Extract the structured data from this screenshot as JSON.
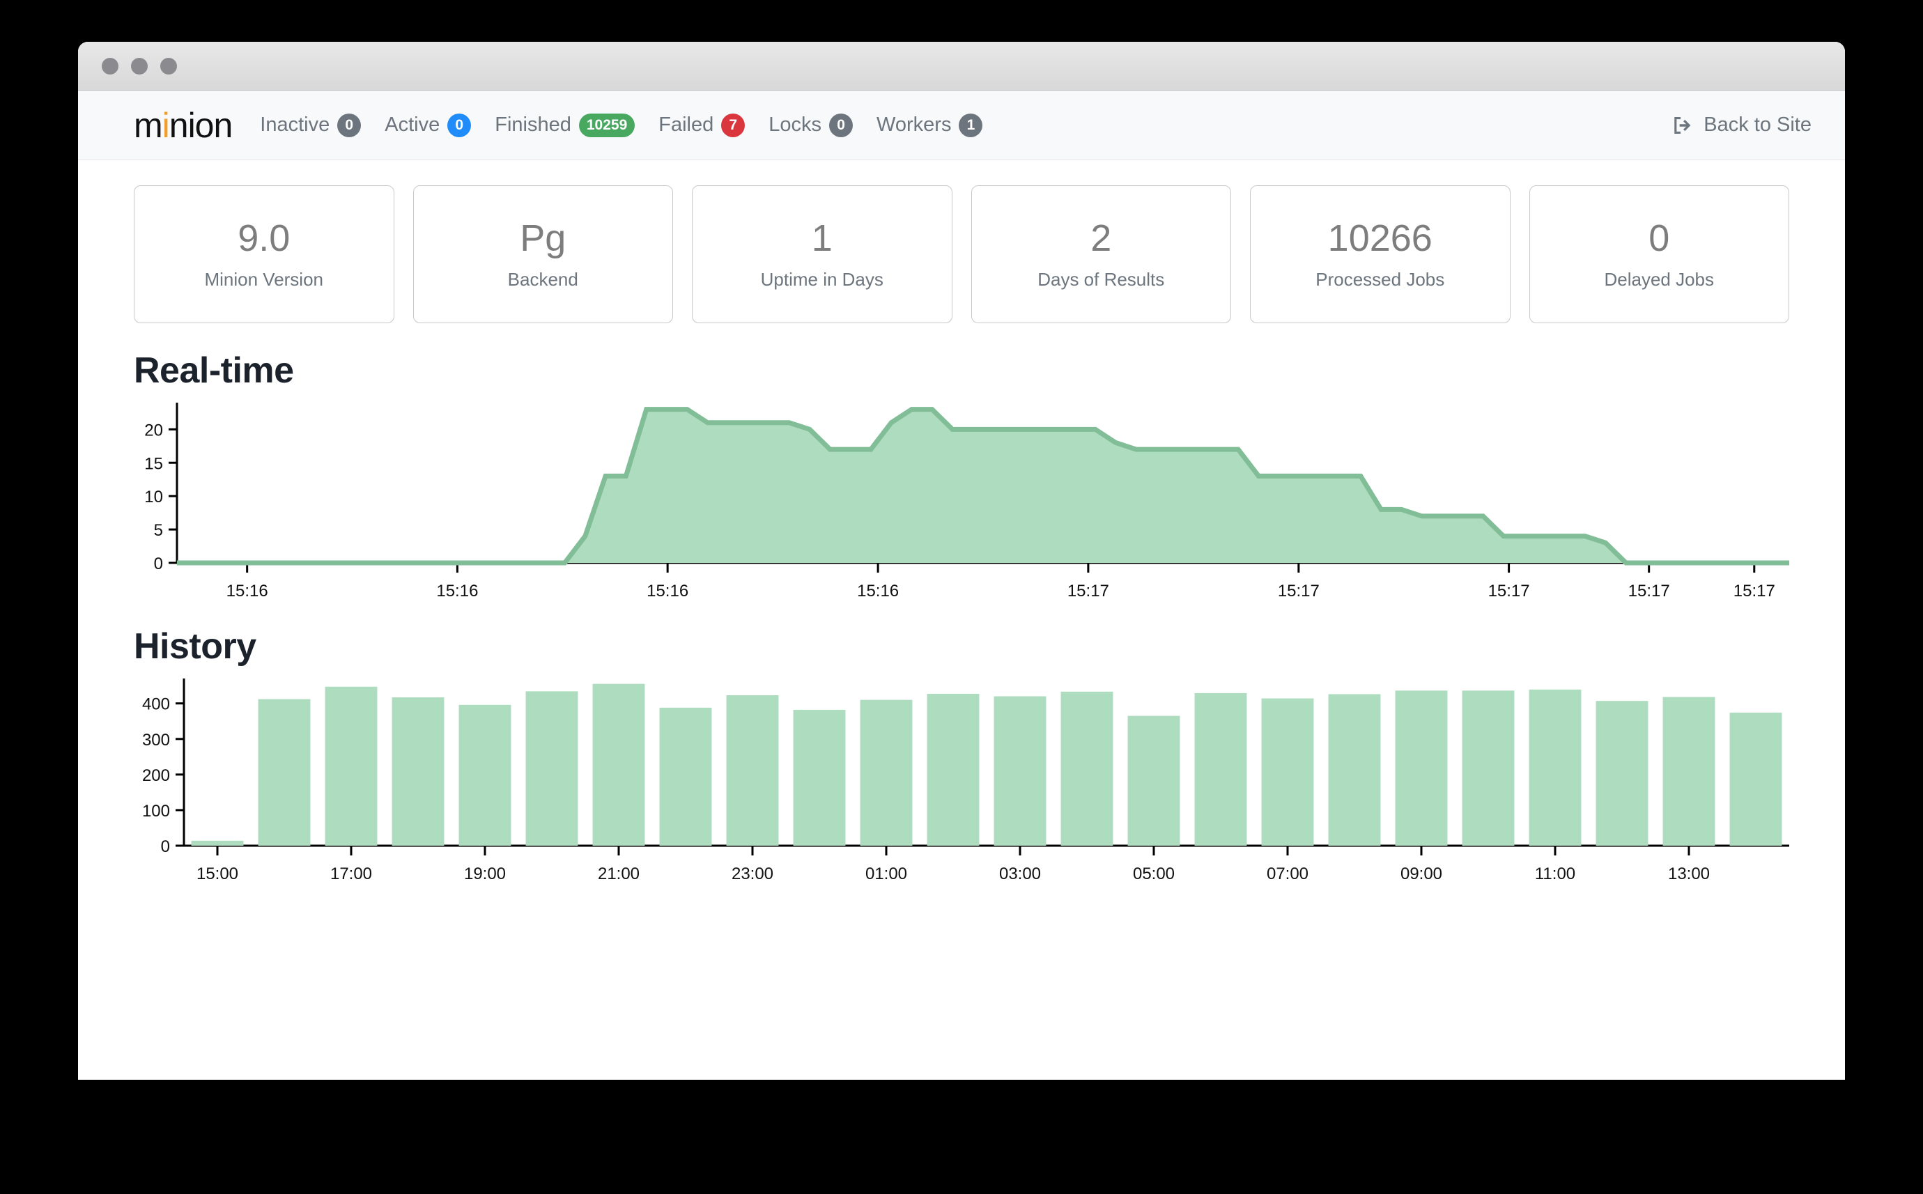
{
  "window": {
    "traffic_lights": [
      "close",
      "minimize",
      "zoom"
    ]
  },
  "navbar": {
    "brand": "minion",
    "brand_highlight_letter": "i",
    "items": [
      {
        "label": "Inactive",
        "count": "0",
        "color": "#6c757d",
        "name": "inactive"
      },
      {
        "label": "Active",
        "count": "0",
        "color": "#1f8cf9",
        "name": "active"
      },
      {
        "label": "Finished",
        "count": "10259",
        "color": "#49a860",
        "name": "finished"
      },
      {
        "label": "Failed",
        "count": "7",
        "color": "#d9363e",
        "name": "failed"
      },
      {
        "label": "Locks",
        "count": "0",
        "color": "#6c757d",
        "name": "locks"
      },
      {
        "label": "Workers",
        "count": "1",
        "color": "#6c757d",
        "name": "workers"
      }
    ],
    "back_to_site": "Back to Site",
    "back_icon": "sign-out-icon"
  },
  "stats": [
    {
      "value": "9.0",
      "label": "Minion Version"
    },
    {
      "value": "Pg",
      "label": "Backend"
    },
    {
      "value": "1",
      "label": "Uptime in Days"
    },
    {
      "value": "2",
      "label": "Days of Results"
    },
    {
      "value": "10266",
      "label": "Processed Jobs"
    },
    {
      "value": "0",
      "label": "Delayed Jobs"
    }
  ],
  "sections": {
    "realtime_title": "Real-time",
    "history_title": "History"
  },
  "chart_data": [
    {
      "id": "realtime",
      "type": "area",
      "title": "Real-time",
      "xlabel": "",
      "ylabel": "",
      "grid": false,
      "legend": false,
      "ylim": [
        0,
        24
      ],
      "yticks": [
        0,
        5,
        10,
        15,
        20
      ],
      "ytick_labels": [
        "0",
        "5",
        "10",
        "15",
        "20"
      ],
      "xtick_labels": [
        "15:16",
        "15:16",
        "15:16",
        "15:16",
        "15:17",
        "15:17",
        "15:17",
        "15:17",
        "15:17"
      ],
      "xtick_positions": [
        0.0435,
        0.1739,
        0.3043,
        0.4348,
        0.5652,
        0.6957,
        0.8261,
        0.913,
        0.9783
      ],
      "series": [
        {
          "name": "Active jobs",
          "values": [
            0,
            0,
            0,
            0,
            0,
            0,
            0,
            0,
            0,
            0,
            0,
            0,
            0,
            0,
            0,
            0,
            0,
            0,
            0,
            0,
            4,
            13,
            13,
            23,
            23,
            23,
            21,
            21,
            21,
            21,
            21,
            20,
            17,
            17,
            17,
            21,
            23,
            23,
            20,
            20,
            20,
            20,
            20,
            20,
            20,
            20,
            18,
            17,
            17,
            17,
            17,
            17,
            17,
            13,
            13,
            13,
            13,
            13,
            13,
            8,
            8,
            7,
            7,
            7,
            7,
            4,
            4,
            4,
            4,
            4,
            3,
            0,
            0,
            0,
            0,
            0,
            0,
            0,
            0,
            0
          ]
        }
      ]
    },
    {
      "id": "history",
      "type": "bar",
      "title": "History",
      "xlabel": "",
      "ylabel": "",
      "grid": false,
      "legend": false,
      "ylim": [
        0,
        470
      ],
      "yticks": [
        0,
        100,
        200,
        300,
        400
      ],
      "ytick_labels": [
        "0",
        "100",
        "200",
        "300",
        "400"
      ],
      "xtick_labels": [
        "15:00",
        "17:00",
        "19:00",
        "21:00",
        "23:00",
        "01:00",
        "03:00",
        "05:00",
        "07:00",
        "09:00",
        "11:00",
        "13:00"
      ],
      "categories": [
        "15:00",
        "16:00",
        "17:00",
        "18:00",
        "19:00",
        "20:00",
        "21:00",
        "22:00",
        "23:00",
        "00:00",
        "01:00",
        "02:00",
        "03:00",
        "04:00",
        "05:00",
        "06:00",
        "07:00",
        "08:00",
        "09:00",
        "10:00",
        "11:00",
        "12:00",
        "13:00",
        "14:00"
      ],
      "values": [
        14,
        412,
        447,
        417,
        396,
        434,
        455,
        388,
        423,
        382,
        410,
        427,
        420,
        433,
        365,
        429,
        414,
        426,
        436,
        436,
        439,
        407,
        418,
        374
      ]
    }
  ]
}
